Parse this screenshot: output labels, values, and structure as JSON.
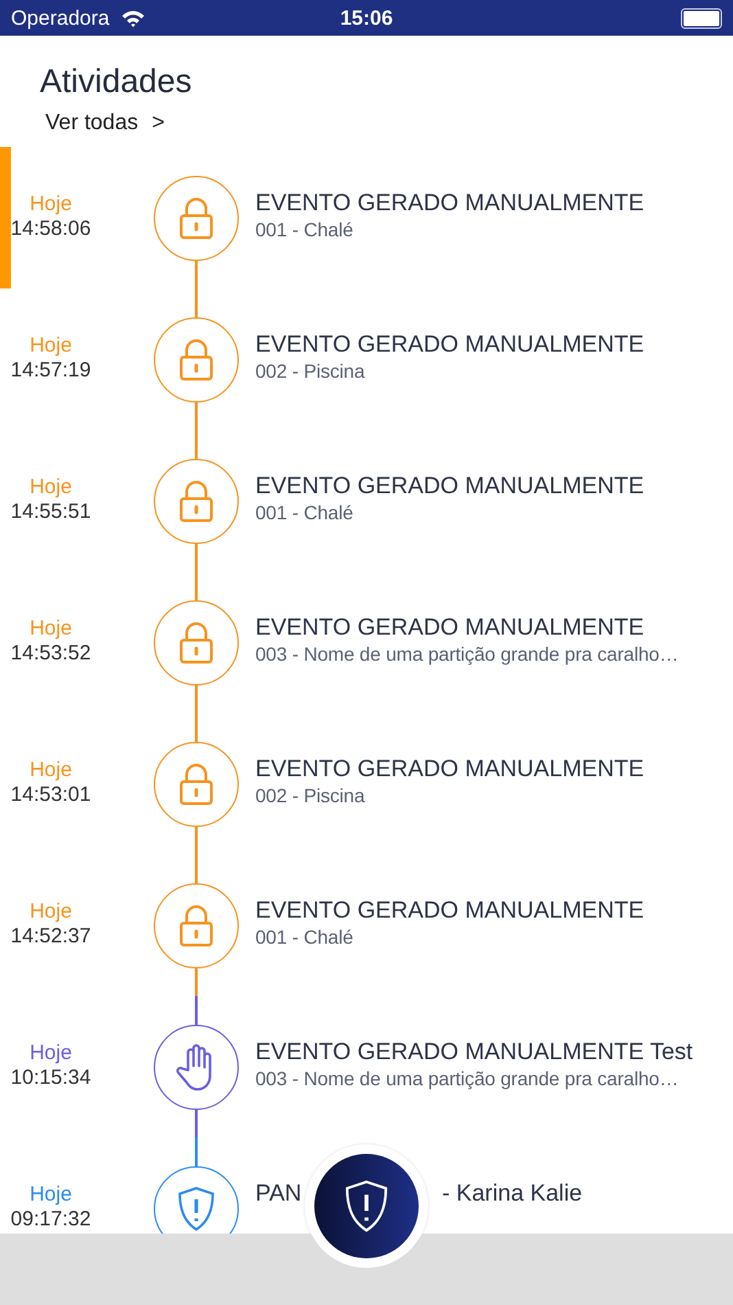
{
  "status_bar": {
    "carrier": "Operadora",
    "time": "15:06"
  },
  "header": {
    "title": "Atividades",
    "link": "Ver todas",
    "link_arrow": ">"
  },
  "items": [
    {
      "kind": "lock",
      "color": "#f7931e",
      "selected": true,
      "day": "Hoje",
      "time": "14:58:06",
      "title": "EVENTO GERADO MANUALMENTE",
      "subtitle": "001 - Chalé"
    },
    {
      "kind": "lock",
      "color": "#f7931e",
      "selected": false,
      "day": "Hoje",
      "time": "14:57:19",
      "title": "EVENTO GERADO MANUALMENTE",
      "subtitle": "002 - Piscina"
    },
    {
      "kind": "lock",
      "color": "#f7931e",
      "selected": false,
      "day": "Hoje",
      "time": "14:55:51",
      "title": "EVENTO GERADO MANUALMENTE",
      "subtitle": "001 - Chalé"
    },
    {
      "kind": "lock",
      "color": "#f7931e",
      "selected": false,
      "day": "Hoje",
      "time": "14:53:52",
      "title": "EVENTO GERADO MANUALMENTE",
      "subtitle": "003 - Nome de uma partição grande pra caralho…"
    },
    {
      "kind": "lock",
      "color": "#f7931e",
      "selected": false,
      "day": "Hoje",
      "time": "14:53:01",
      "title": "EVENTO GERADO MANUALMENTE",
      "subtitle": "002 - Piscina"
    },
    {
      "kind": "lock",
      "color": "#f7931e",
      "selected": false,
      "day": "Hoje",
      "time": "14:52:37",
      "title": "EVENTO GERADO MANUALMENTE",
      "subtitle": "001 - Chalé"
    },
    {
      "kind": "hand",
      "color": "#6a5fe0",
      "selected": false,
      "day": "Hoje",
      "time": "10:15:34",
      "title": "EVENTO GERADO MANUALMENTE Test",
      "subtitle": "003 - Nome de uma partição grande pra caralho…"
    },
    {
      "kind": "shield",
      "color": "#2d8cf0",
      "selected": false,
      "day": "Hoje",
      "time": "09:17:32",
      "title": "PAN",
      "title_after": "- Karina Kalie"
    }
  ]
}
